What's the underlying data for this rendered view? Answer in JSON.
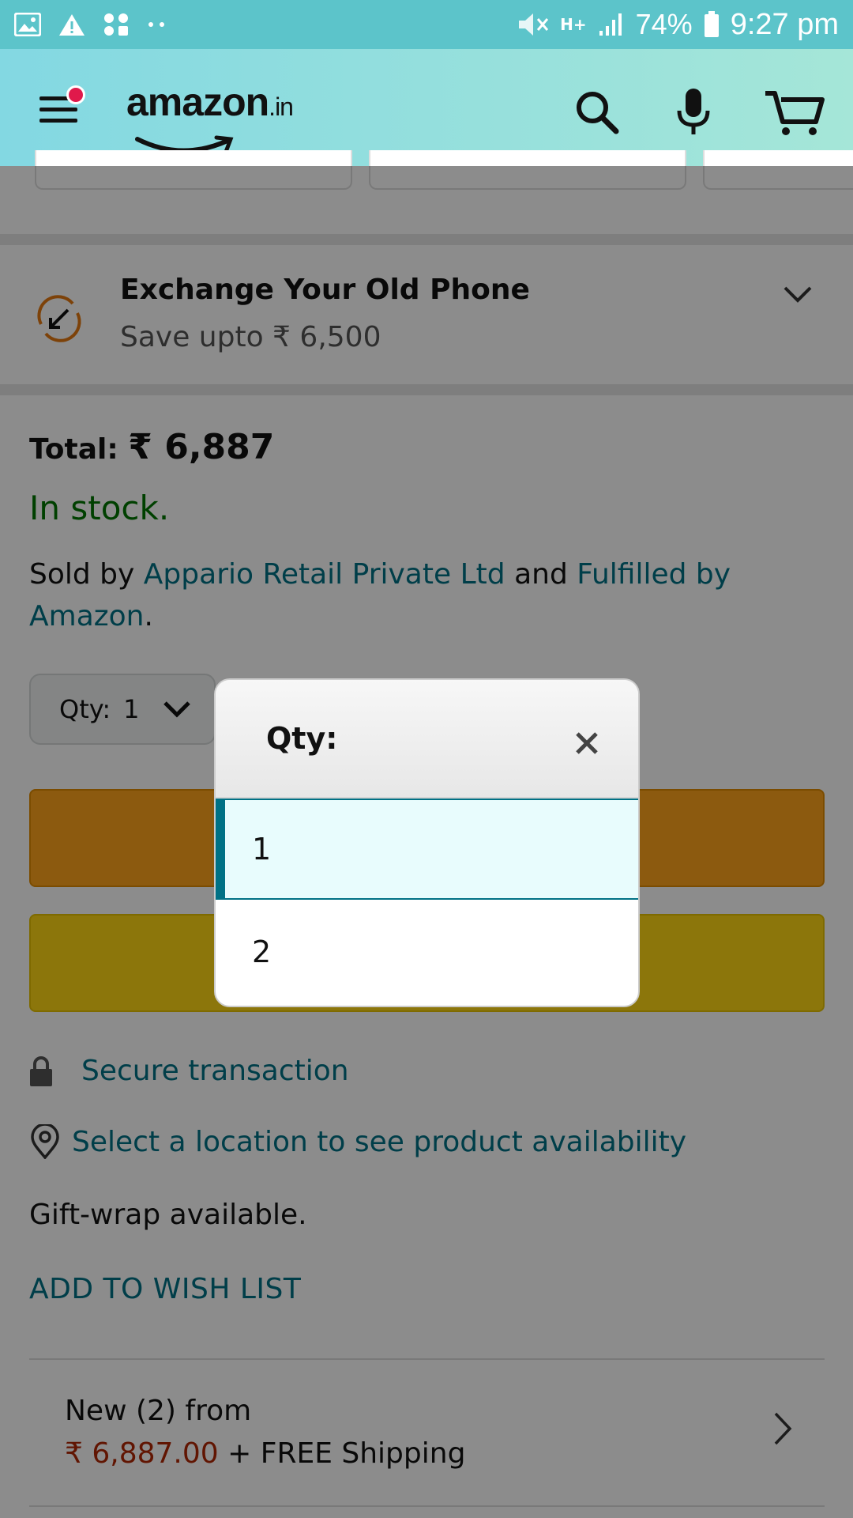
{
  "status_bar": {
    "battery": "74%",
    "time": "9:27 pm",
    "network": "H+"
  },
  "header": {
    "logo_text": "amazon",
    "logo_suffix": ".in"
  },
  "exchange": {
    "title": "Exchange Your Old Phone",
    "subtitle": "Save upto ₹ 6,500"
  },
  "product": {
    "total_label": "Total:",
    "total_value": "₹ 6,887",
    "stock": "In stock.",
    "sold_by_prefix": "Sold by",
    "seller": "Appario Retail Private Ltd",
    "and": "and",
    "fulfilled": "Fulfilled by Amazon",
    "period": "."
  },
  "qty_selector": {
    "label": "Qty:",
    "value": "1"
  },
  "links": {
    "secure": "Secure transaction",
    "location": "Select a location to see product availability",
    "giftwrap": "Gift-wrap available.",
    "wishlist": "ADD TO WISH LIST"
  },
  "new_from": {
    "label": "New (2) from",
    "price": "₹ 6,887.00",
    "shipping": "+ FREE Shipping"
  },
  "modal": {
    "title": "Qty:",
    "options": [
      "1",
      "2"
    ],
    "selected": "1"
  },
  "colors": {
    "status_bar": "#5cc4ca",
    "link": "#007185",
    "in_stock": "#007600",
    "price": "#b12704",
    "cart_button": "#ffa41c",
    "buy_button": "#ffd814",
    "selected_option": "#e8fcfd"
  }
}
